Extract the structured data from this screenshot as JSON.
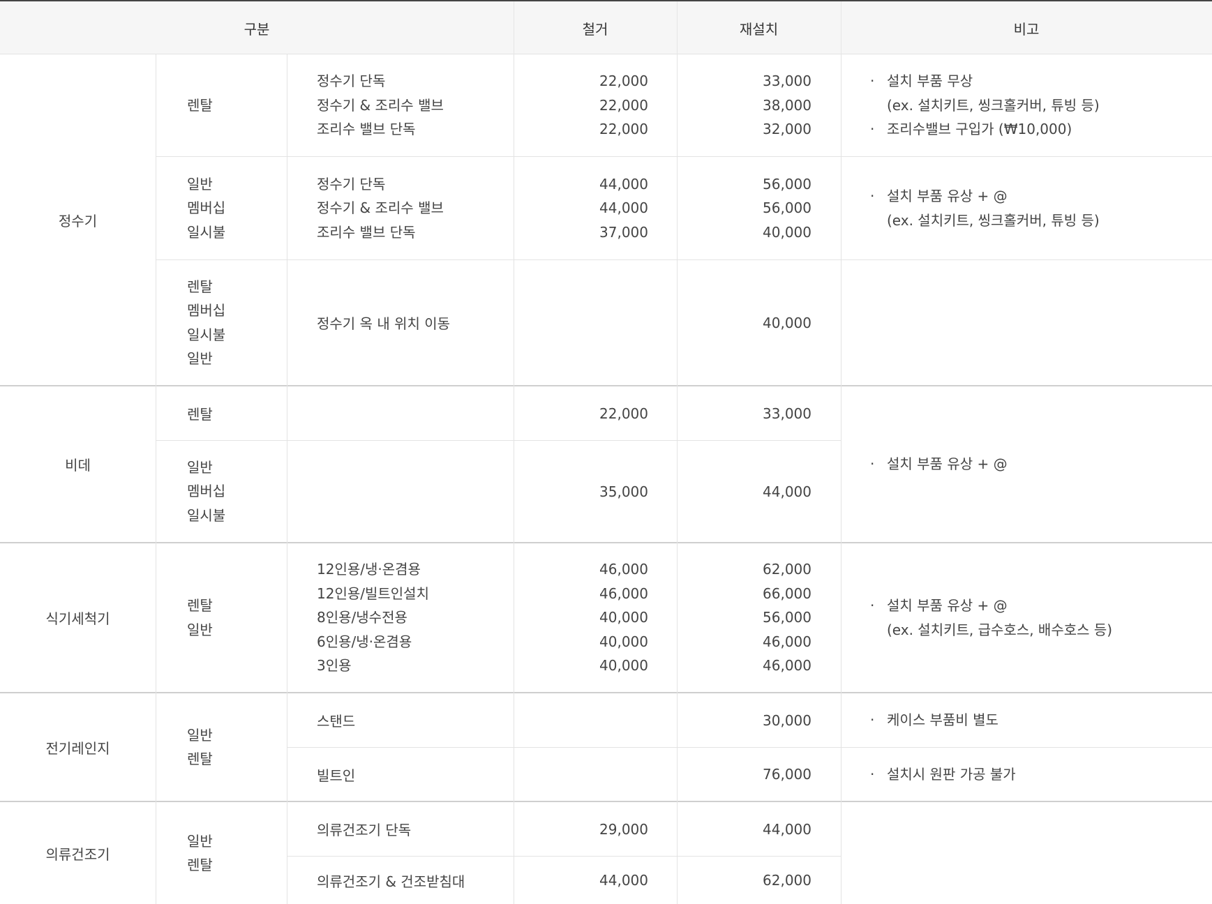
{
  "header": {
    "category": "구분",
    "removal": "철거",
    "reinstall": "재설치",
    "remarks": "비고"
  },
  "water_purifier": {
    "name": "정수기",
    "groups": [
      {
        "type_lines": [
          "렌탈"
        ],
        "item_lines": [
          "정수기 단독",
          "정수기 & 조리수 밸브",
          "조리수 밸브 단독"
        ],
        "removal_lines": [
          "22,000",
          "22,000",
          "22,000"
        ],
        "reinstall_lines": [
          "33,000",
          "38,000",
          "32,000"
        ],
        "note": {
          "bullet_1": "설치 부품 무상",
          "sub_1": "(ex. 설치키트, 씽크홀커버, 튜빙 등)",
          "bullet_2": "조리수밸브 구입가 (₩10,000)"
        }
      },
      {
        "type_lines": [
          "일반",
          "멤버십",
          "일시불"
        ],
        "item_lines": [
          "정수기 단독",
          "정수기 & 조리수 밸브",
          "조리수 밸브 단독"
        ],
        "removal_lines": [
          "44,000",
          "44,000",
          "37,000"
        ],
        "reinstall_lines": [
          "56,000",
          "56,000",
          "40,000"
        ],
        "note": {
          "bullet_1": "설치 부품 유상 + @",
          "sub_1": "(ex. 설치키트, 씽크홀커버, 튜빙 등)"
        }
      },
      {
        "type_lines": [
          "렌탈",
          "멤버십",
          "일시불",
          "일반"
        ],
        "item": "정수기 옥 내 위치 이동",
        "reinstall": "40,000"
      }
    ]
  },
  "bidet": {
    "name": "비데",
    "rows": [
      {
        "type_lines": [
          "렌탈"
        ],
        "removal": "22,000",
        "reinstall": "33,000"
      },
      {
        "type_lines": [
          "일반",
          "멤버십",
          "일시불"
        ],
        "removal": "35,000",
        "reinstall": "44,000"
      }
    ],
    "note": "설치 부품 유상 + @"
  },
  "dishwasher": {
    "name": "식기세척기",
    "type_lines": [
      "렌탈",
      "일반"
    ],
    "item_lines": [
      "12인용/냉·온겸용",
      "12인용/빌트인설치",
      "8인용/냉수전용",
      "6인용/냉·온겸용",
      "3인용"
    ],
    "removal_lines": [
      "46,000",
      "46,000",
      "40,000",
      "40,000",
      "40,000"
    ],
    "reinstall_lines": [
      "62,000",
      "66,000",
      "56,000",
      "46,000",
      "46,000"
    ],
    "note": {
      "bullet_1": "설치 부품 유상 + @",
      "sub_1": "(ex. 설치키트, 급수호스, 배수호스 등)"
    }
  },
  "electric_range": {
    "name": "전기레인지",
    "type_lines": [
      "일반",
      "렌탈"
    ],
    "rows": [
      {
        "item": "스탠드",
        "reinstall": "30,000",
        "note": "케이스 부품비 별도"
      },
      {
        "item": "빌트인",
        "reinstall": "76,000",
        "note": "설치시 원판 가공 불가"
      }
    ]
  },
  "dryer": {
    "name": "의류건조기",
    "type_lines": [
      "일반",
      "렌탈"
    ],
    "rows": [
      {
        "item": "의류건조기 단독",
        "removal": "29,000",
        "reinstall": "44,000"
      },
      {
        "item": "의류건조기 & 건조받침대",
        "removal": "44,000",
        "reinstall": "62,000"
      }
    ]
  },
  "bullet_char": "·"
}
